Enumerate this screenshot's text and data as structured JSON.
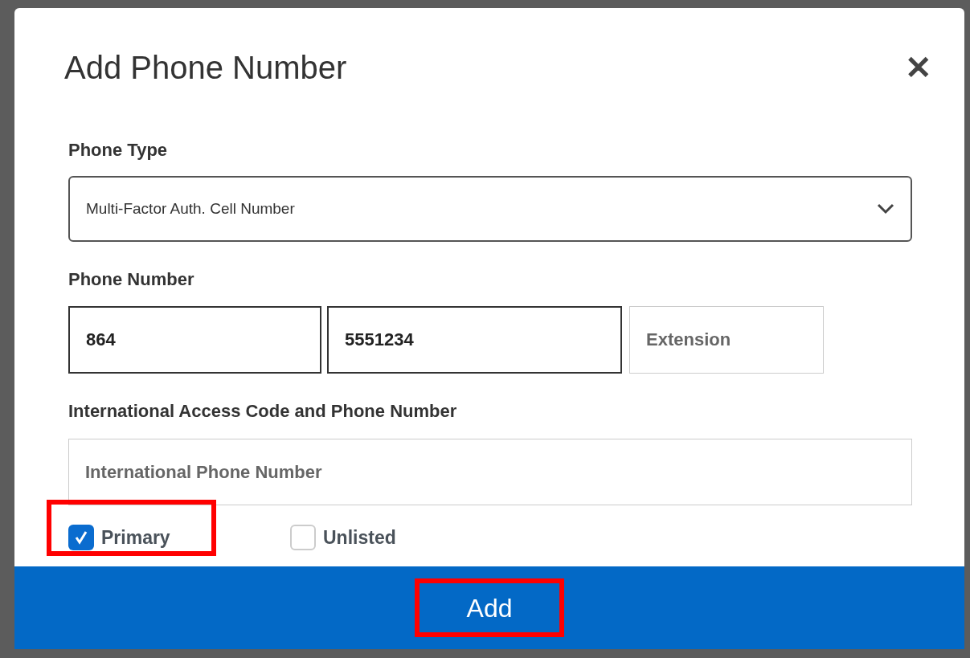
{
  "dialog": {
    "title": "Add Phone Number",
    "close": "✕"
  },
  "phone_type": {
    "label": "Phone Type",
    "value": "Multi-Factor Auth. Cell Number"
  },
  "phone_number": {
    "label": "Phone Number",
    "fields": [
      {
        "kind": "value",
        "value": "864"
      },
      {
        "kind": "value",
        "value": "5551234"
      },
      {
        "kind": "placeholder",
        "placeholder": "Extension"
      }
    ]
  },
  "international": {
    "label": "International Access Code and Phone Number",
    "placeholder": "International Phone Number"
  },
  "options": [
    {
      "label": "Primary",
      "checked": true,
      "highlighted": true
    },
    {
      "label": "Unlisted",
      "checked": false,
      "highlighted": false
    }
  ],
  "footer": {
    "button": {
      "label": "Add",
      "highlighted": true
    }
  }
}
